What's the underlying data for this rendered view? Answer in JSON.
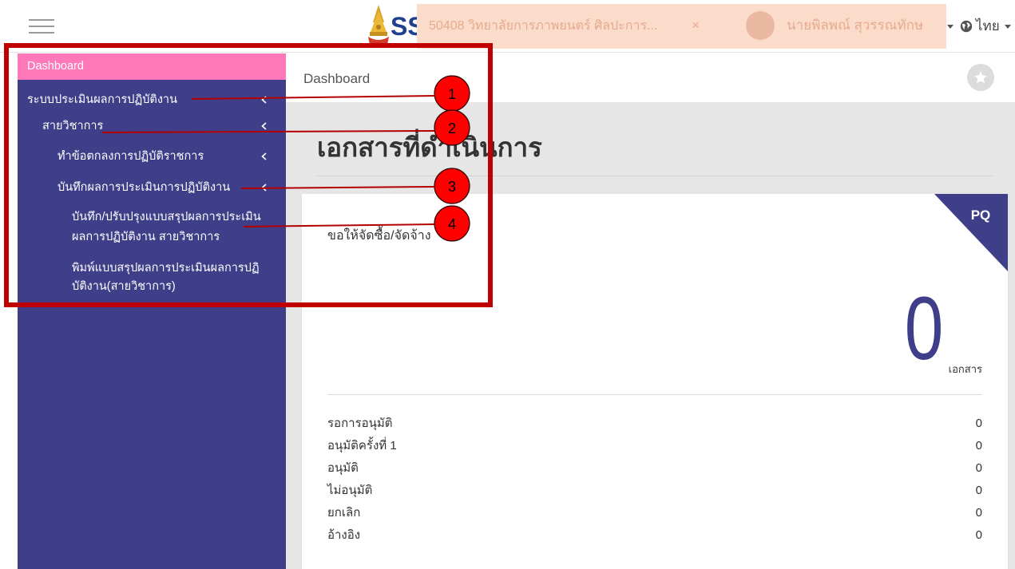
{
  "topbar": {
    "menu_icon": "hamburger-icon",
    "logo_icon": "emblem-icon",
    "logo_text": "SS",
    "org_selector": "50408 วิทยาลัยการภาพยนตร์ ศิลปะการ...",
    "org_clear": "×",
    "user_avatar": "avatar-icon",
    "user_name": "นายพิลพณ์ สุวรรณทักษ",
    "language_icon": "globe-icon",
    "language": "ไทย"
  },
  "sidebar": {
    "dashboard": "Dashboard",
    "expand_icon": "chevron-left-icon",
    "items": [
      {
        "label": "ระบบประเมินผลการปฏิบัติงาน"
      },
      {
        "label": "สายวิชาการ"
      },
      {
        "label": "ทำข้อตกลงการปฏิบัติราชการ"
      },
      {
        "label": "บันทึกผลการประเมินการปฏิบัติงาน"
      },
      {
        "lines": [
          "บันทึก/ปรับปรุงแบบสรุปผลการประเมิน",
          "ผลการปฏิบัติงาน สายวิชาการ"
        ]
      },
      {
        "lines": [
          "พิมพ์แบบสรุปผลการประเมินผลการปฏิ",
          "บัติงาน(สายวิชาการ)"
        ]
      }
    ]
  },
  "breadcrumb": {
    "current": "Dashboard",
    "favorite_icon": "star-icon"
  },
  "page": {
    "heading": "เอกสารที่ดำเนินการ"
  },
  "card": {
    "badge": "PQ",
    "title": "ขอให้จัดซื้อ/จัดจ้าง",
    "count": 0,
    "count_unit": "เอกสาร",
    "statuses": [
      {
        "label": "รอการอนุมัติ",
        "value": 0
      },
      {
        "label": "อนุมัติครั้งที่ 1",
        "value": 0
      },
      {
        "label": "อนุมัติ",
        "value": 0
      },
      {
        "label": "ไม่อนุมัติ",
        "value": 0
      },
      {
        "label": "ยกเลิก",
        "value": 0
      },
      {
        "label": "อ้างอิง",
        "value": 0
      }
    ]
  },
  "annotations": {
    "markers": [
      "1",
      "2",
      "3",
      "4"
    ]
  },
  "colors": {
    "sidebar_bg": "#3f3e89",
    "active_item": "#ff78b9",
    "accent": "#3f3e89",
    "content_bg": "#e6e6e6",
    "redaction": "#fbdccb",
    "annotation_box": "#c00000",
    "annotation_marker": "#ff0000"
  }
}
